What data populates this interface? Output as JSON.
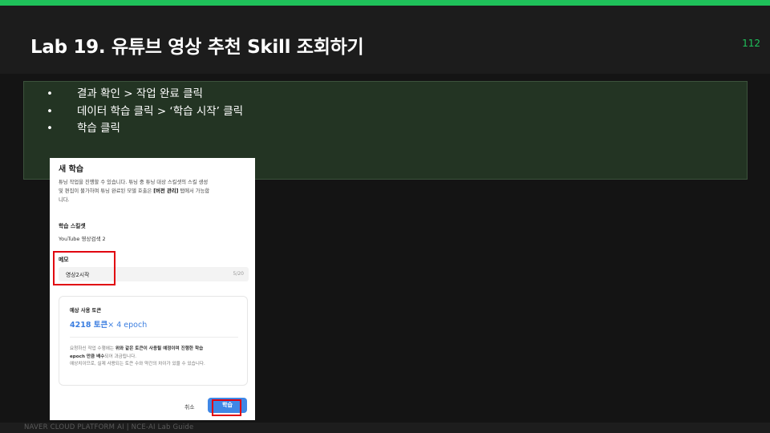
{
  "slide": {
    "title": "Lab 19. 유튜브 영상 추천 Skill 조회하기",
    "page_number": "112",
    "bullets": [
      "결과 확인 > 작업 완료 클릭",
      "데이터 학습 클릭 > ‘학습 시작’ 클릭",
      "학습 클릭"
    ],
    "bullet_glyph": "•",
    "footer": "NAVER CLOUD PLATFORM AI  |  NCE-AI Lab Guide",
    "accent_color": "#1fc15a"
  },
  "dialog": {
    "title": "새 학습",
    "description_line1": "튜닝 작업을 진행할 수 있습니다. 튜닝 중 튜닝 대상 스킬셋의 스킬 생성",
    "description_line2_pre": "및 편집이 불가하며 튜닝 완료된 모델 호출은 ",
    "description_line2_bold": "[버전 관리]",
    "description_line2_post": " 탭에서 가능합",
    "description_line3": "니다.",
    "skillset_label": "학습 스킬셋",
    "skillset_value": "YouTube 영상검색 2",
    "memo_label": "메모",
    "memo_value": "영상2시작",
    "memo_counter": "5/20",
    "estimate_title": "예상 사용 토큰",
    "estimate_tokens": "4218 토큰",
    "estimate_epoch": "× 4 epoch",
    "note_line1_pre": "요청하신 작업 수행에는 ",
    "note_line1_bold": "위와 같은 토큰이 사용될 예정이며 진행한 학습",
    "note_line2_bold": "epoch 만큼 배수",
    "note_line2_post": "되어 과금됩니다.",
    "note_line3": "예상치이므로, 실제 사용되는 토큰 수와 약간의 차이가 있을 수 있습니다.",
    "cancel_label": "취소",
    "submit_label": "학습",
    "highlight_color": "#e1000f",
    "button_color": "#3f87e6"
  }
}
